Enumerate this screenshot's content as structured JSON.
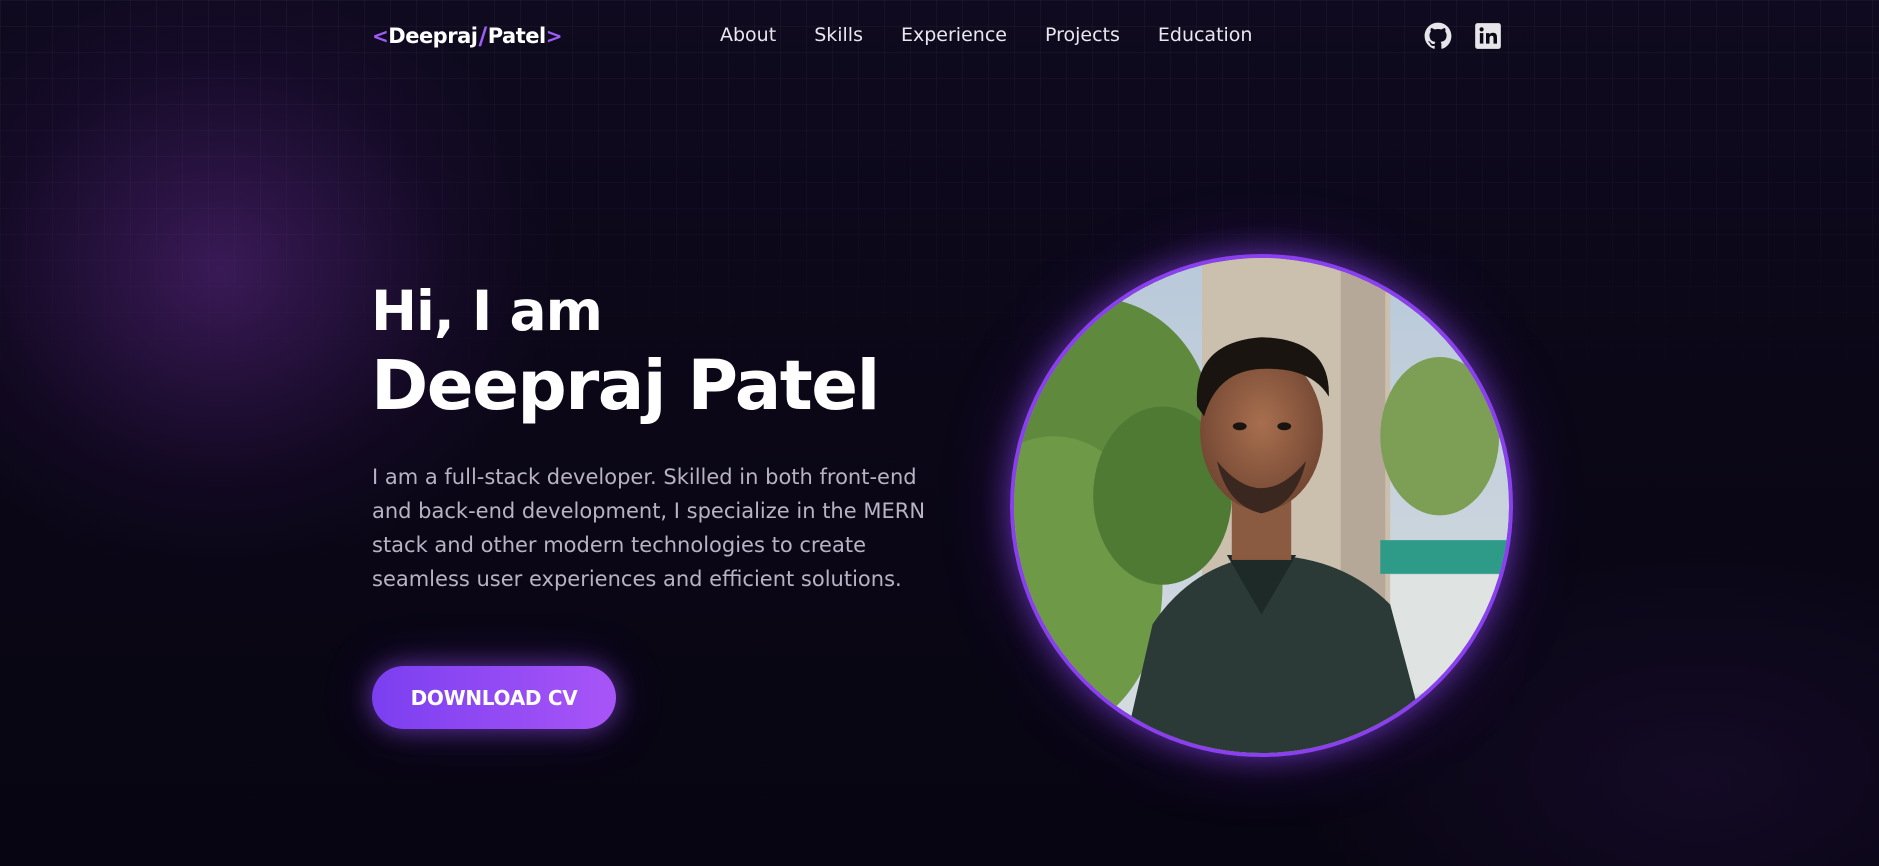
{
  "nav": {
    "logo": {
      "open": "<",
      "first": "Deepraj",
      "slash": "/",
      "last": "Patel",
      "close": ">"
    },
    "links": [
      "About",
      "Skills",
      "Experience",
      "Projects",
      "Education"
    ],
    "social": [
      "github-icon",
      "linkedin-icon"
    ]
  },
  "hero": {
    "greeting": "Hi, I am",
    "name": "Deepraj Patel",
    "bio": "I am a full-stack developer. Skilled in both front-end and back-end development, I specialize in the MERN stack and other modern technologies to create seamless user experiences and efficient solutions.",
    "cta": "DOWNLOAD CV",
    "photo": "profile-photo"
  },
  "colors": {
    "accent": "#9d5cf5",
    "button_start": "#7b3ff0",
    "button_end": "#a855f7",
    "background": "#0b0717",
    "text_muted": "#b7b3c4"
  }
}
